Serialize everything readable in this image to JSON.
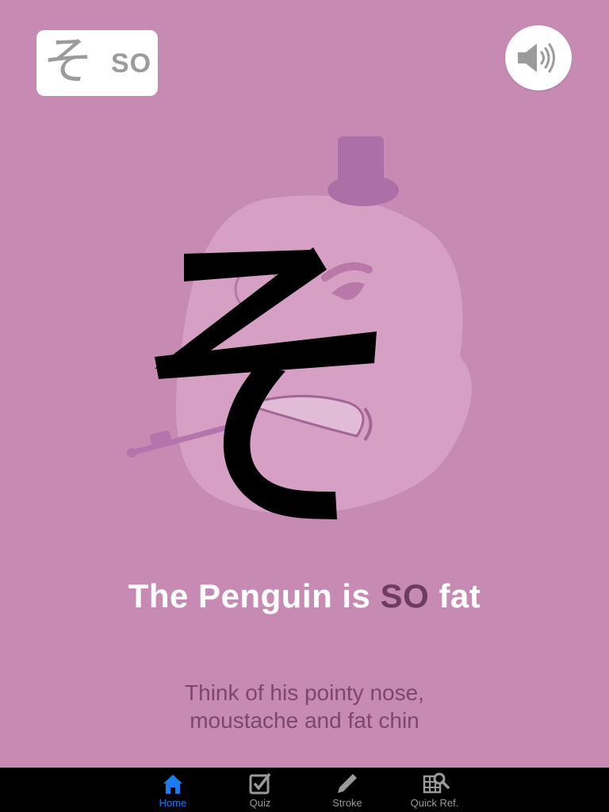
{
  "badge": {
    "kana": "そ",
    "romaji": "SO"
  },
  "sound_button": {
    "icon": "speaker-icon"
  },
  "illustration": {
    "character": "そ",
    "icon": "penguin-mnemonic"
  },
  "mnemonic": {
    "prefix": "The Penguin is ",
    "highlight": "SO",
    "suffix": " fat",
    "highlight_color": "#6e3c5e"
  },
  "hint": {
    "line1": "Think of his pointy nose,",
    "line2": "moustache and fat chin"
  },
  "tabs": [
    {
      "label": "Home",
      "icon": "home-icon",
      "active": true
    },
    {
      "label": "Quiz",
      "icon": "quiz-checkbox-icon",
      "active": false
    },
    {
      "label": "Stroke",
      "icon": "pencil-icon",
      "active": false
    },
    {
      "label": "Quick Ref.",
      "icon": "grid-search-icon",
      "active": false
    }
  ],
  "colors": {
    "background": "#c78bb3",
    "tabbar": "#000000",
    "active_tab": "#1b7cf0"
  }
}
